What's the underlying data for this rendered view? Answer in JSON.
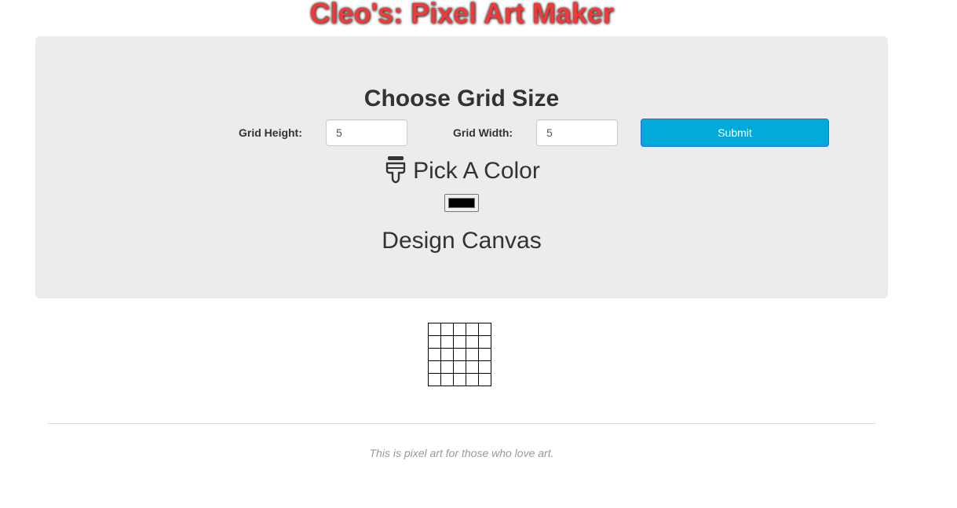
{
  "header": {
    "title": "Cleo's: Pixel Art Maker"
  },
  "grid_size": {
    "heading": "Choose Grid Size",
    "height_label": "Grid Height:",
    "height_value": "5",
    "width_label": "Grid Width:",
    "width_value": "5",
    "submit_label": "Submit"
  },
  "color_picker": {
    "heading": "Pick A Color",
    "icon": "paint-brush-icon",
    "selected_color": "#000000"
  },
  "canvas": {
    "heading": "Design Canvas",
    "rows": 5,
    "columns": 5
  },
  "footer": {
    "text": "This is pixel art for those who love art."
  },
  "colors": {
    "title": "#ec3b3b",
    "panel_background": "#ececec",
    "submit_background": "#02a9d9"
  }
}
